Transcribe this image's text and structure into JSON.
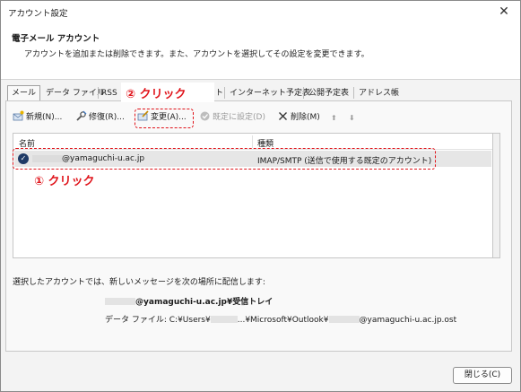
{
  "window": {
    "title": "アカウント設定",
    "close_glyph": "✕"
  },
  "header": {
    "title": "電子メール アカウント",
    "description": "アカウントを追加または削除できます。また、アカウントを選択してその設定を変更できます。"
  },
  "tabs": [
    {
      "label": "メール",
      "active": true
    },
    {
      "label": "データ ファイル"
    },
    {
      "label": "RSS"
    },
    {
      "label": "スト"
    },
    {
      "label": "インターネット予定表"
    },
    {
      "label": "公開予定表"
    },
    {
      "label": "アドレス帳"
    }
  ],
  "toolbar": {
    "new_label": "新規(N)...",
    "repair_label": "修復(R)...",
    "change_label": "変更(A)...",
    "set_default_label": "既定に設定(D)",
    "remove_label": "削除(M)",
    "up_glyph": "⬆",
    "down_glyph": "⬇"
  },
  "list": {
    "columns": [
      "名前",
      "種類"
    ],
    "rows": [
      {
        "name": "@yamaguchi-u.ac.jp",
        "type": "IMAP/SMTP (送信で使用する既定のアカウント)"
      }
    ]
  },
  "deliver": {
    "label": "選択したアカウントでは、新しいメッセージを次の場所に配信します:",
    "path": "@yamaguchi-u.ac.jp¥受信トレイ",
    "datafile_prefix": "データ ファイル: C:¥Users¥",
    "datafile_mid": "...¥Microsoft¥Outlook¥",
    "datafile_suffix": "@yamaguchi-u.ac.jp.ost"
  },
  "buttons": {
    "close_label": "閉じる(C)"
  },
  "annotations": {
    "step1": "① クリック",
    "step2": "② クリック",
    "color": "#e0141b"
  }
}
